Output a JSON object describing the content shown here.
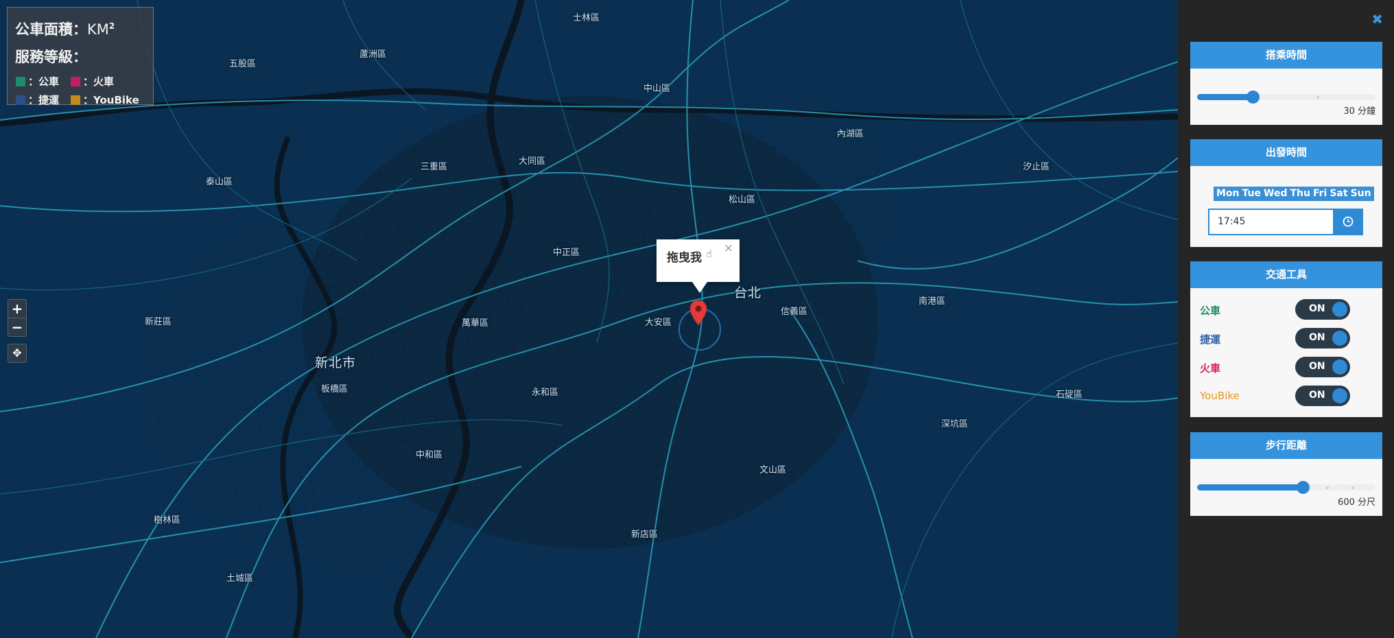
{
  "legend": {
    "area_label": "公車面積：",
    "area_unit": "KM",
    "area_unit_exp": "2",
    "service_label": "服務等級：",
    "items": [
      {
        "label": "：公車",
        "color": "#1f8a6e"
      },
      {
        "label": "：火車",
        "color": "#c21f63"
      },
      {
        "label": "：捷運",
        "color": "#2f4f8a"
      },
      {
        "label": "：YouBike",
        "color": "#c28a20"
      }
    ]
  },
  "map": {
    "zoom_in": "+",
    "zoom_out": "−",
    "locate_icon": "✥",
    "popup_text": "拖曳我",
    "popup_close": "×",
    "marker_color": "#e23b3b",
    "cities": [
      "新北市",
      "台北"
    ],
    "districts": [
      "士林區",
      "五股區",
      "蘆洲區",
      "中山區",
      "內湖區",
      "三重區",
      "大同區",
      "泰山區",
      "松山區",
      "汐止區",
      "中正區",
      "新莊區",
      "萬華區",
      "大安區",
      "信義區",
      "南港區",
      "板橋區",
      "永和區",
      "中和區",
      "文山區",
      "深坑區",
      "石碇區",
      "樹林區",
      "新店區",
      "土城區"
    ]
  },
  "panel": {
    "close_icon": "✖",
    "ride_time": {
      "title": "搭乘時間",
      "value_text": "30 分鐘",
      "fraction": 0.3
    },
    "departure": {
      "title": "出發時間",
      "days": [
        "Mon",
        "Tue",
        "Wed",
        "Thu",
        "Fri",
        "Sat",
        "Sun"
      ],
      "time": "17:45",
      "clock_icon": "clock-icon"
    },
    "transport": {
      "title": "交通工具",
      "items": [
        {
          "label": "公車",
          "state": "ON",
          "color": "#1f8a6e"
        },
        {
          "label": "捷運",
          "state": "ON",
          "color": "#2f62a8"
        },
        {
          "label": "火車",
          "state": "ON",
          "color": "#d61d5c"
        },
        {
          "label": "YouBike",
          "state": "ON",
          "color": "#e8941a"
        }
      ]
    },
    "walk_distance": {
      "title": "步行距離",
      "value_text": "600 分尺",
      "fraction": 0.6
    }
  }
}
